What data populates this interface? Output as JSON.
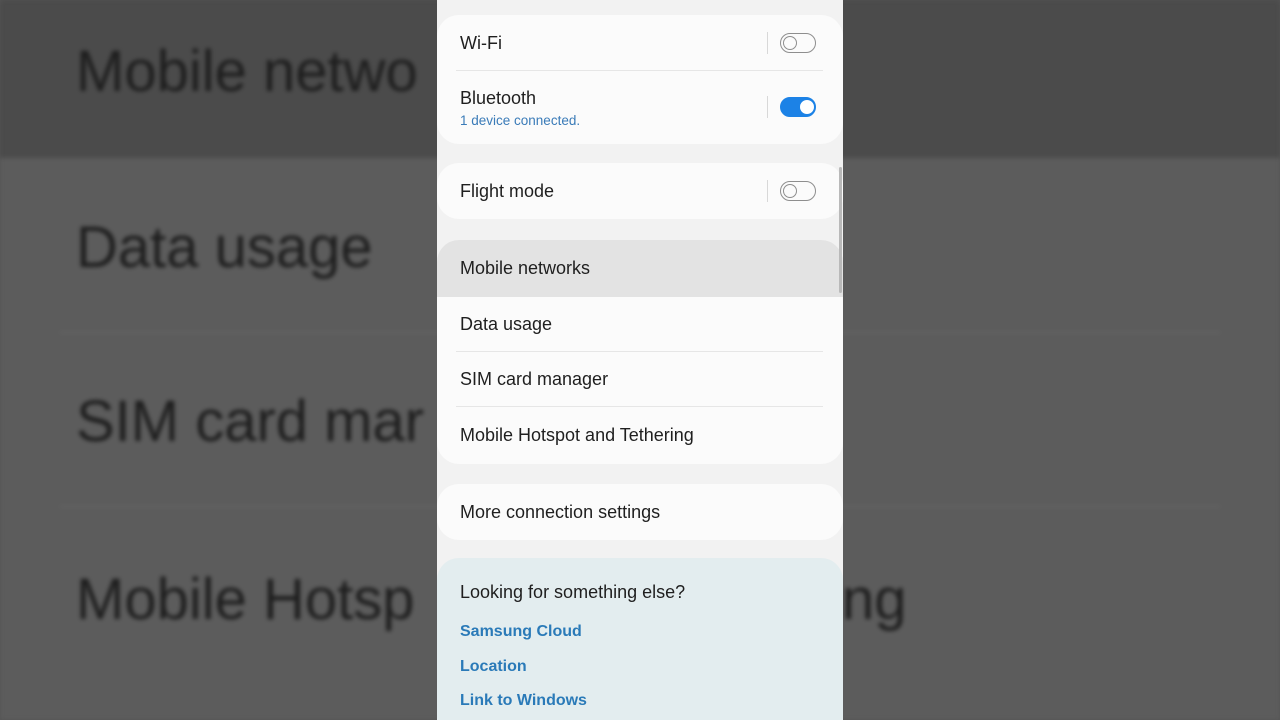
{
  "background": {
    "lines": [
      "Mobile netwo",
      "Data usage",
      "SIM card mar",
      "Mobile Hotsp"
    ],
    "tail": "ng"
  },
  "connections": {
    "wifi": {
      "label": "Wi-Fi",
      "enabled": false
    },
    "bluetooth": {
      "label": "Bluetooth",
      "status": "1 device connected.",
      "enabled": true
    },
    "flight_mode": {
      "label": "Flight mode",
      "enabled": false
    },
    "items": [
      {
        "label": "Mobile networks"
      },
      {
        "label": "Data usage"
      },
      {
        "label": "SIM card manager"
      },
      {
        "label": "Mobile Hotspot and Tethering"
      }
    ],
    "more": {
      "label": "More connection settings"
    }
  },
  "suggestions": {
    "title": "Looking for something else?",
    "links": [
      "Samsung Cloud",
      "Location",
      "Link to Windows"
    ]
  },
  "colors": {
    "toggle_on": "#1c82e6",
    "link": "#2a7ab8",
    "highlight": "#e3e3e3"
  }
}
